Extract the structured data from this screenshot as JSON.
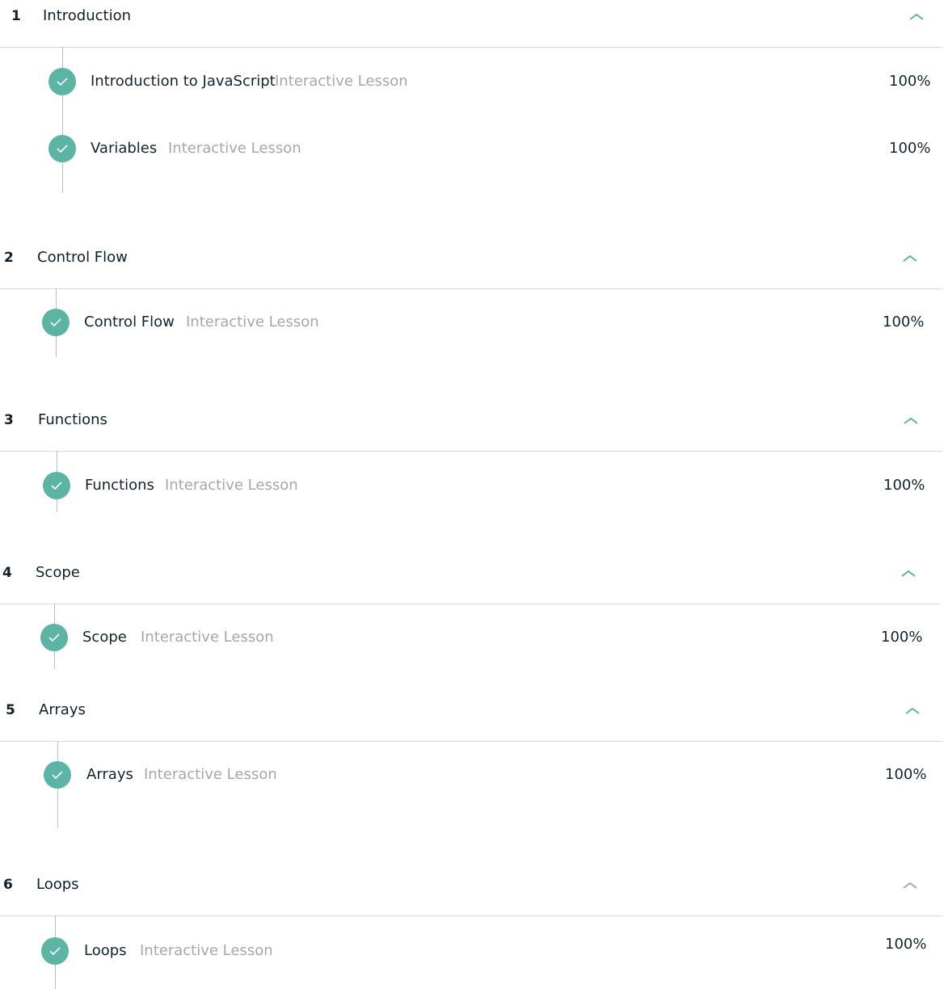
{
  "colors": {
    "accent": "#5bb4a4",
    "chevron": "#5bb4a4",
    "divider": "#d6d9dc",
    "lesson_type": "#a3a8ad"
  },
  "sections": [
    {
      "number": "1",
      "title": "Introduction",
      "lessons": [
        {
          "title": "Introduction to JavaScript",
          "type": "Interactive Lesson",
          "progress": "100%"
        },
        {
          "title": "Variables",
          "type": "Interactive Lesson",
          "progress": "100%"
        }
      ]
    },
    {
      "number": "2",
      "title": "Control Flow",
      "lessons": [
        {
          "title": "Control Flow",
          "type": "Interactive Lesson",
          "progress": "100%"
        }
      ]
    },
    {
      "number": "3",
      "title": "Functions",
      "lessons": [
        {
          "title": "Functions",
          "type": "Interactive Lesson",
          "progress": "100%"
        }
      ]
    },
    {
      "number": "4",
      "title": "Scope",
      "lessons": [
        {
          "title": "Scope",
          "type": "Interactive Lesson",
          "progress": "100%"
        }
      ]
    },
    {
      "number": "5",
      "title": "Arrays",
      "lessons": [
        {
          "title": "Arrays",
          "type": "Interactive Lesson",
          "progress": "100%"
        }
      ]
    },
    {
      "number": "6",
      "title": "Loops",
      "lessons": [
        {
          "title": "Loops",
          "type": "Interactive Lesson",
          "progress": "100%"
        }
      ]
    }
  ]
}
